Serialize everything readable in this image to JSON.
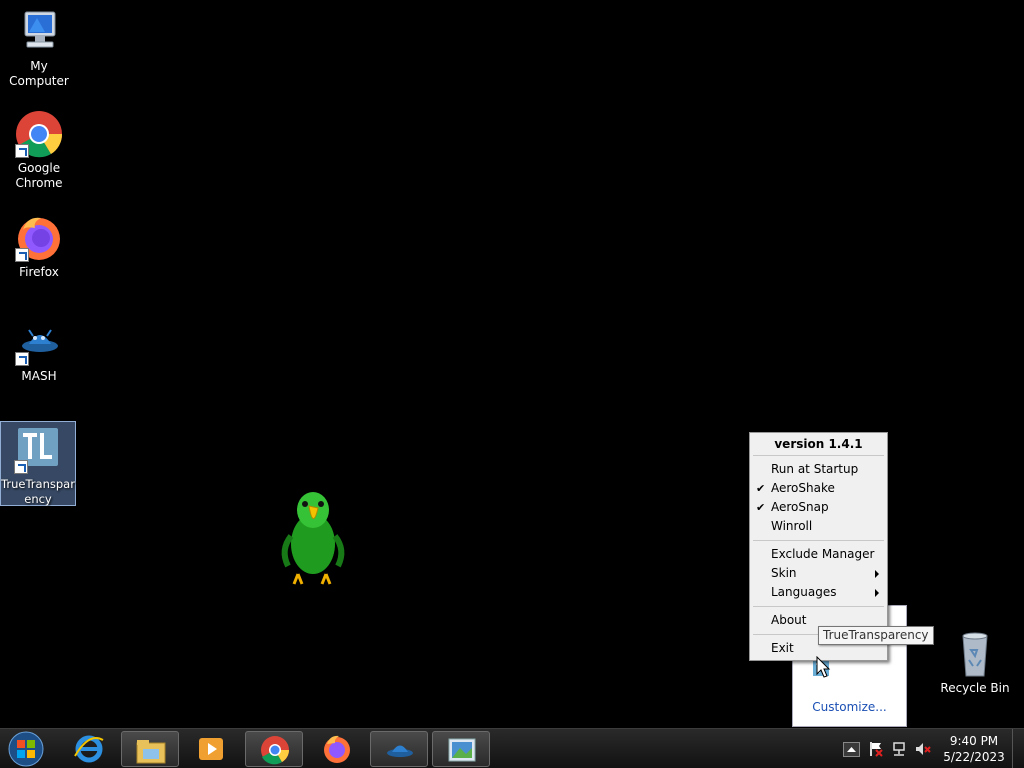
{
  "desktop": {
    "icons": [
      {
        "label": "My Computer"
      },
      {
        "label": "Google Chrome"
      },
      {
        "label": "Firefox"
      },
      {
        "label": "MASH"
      },
      {
        "label": "TrueTransparency"
      },
      {
        "label": "Recycle Bin"
      }
    ]
  },
  "menu": {
    "version": "version 1.4.1",
    "items": [
      {
        "label": "Run at Startup",
        "checked": false
      },
      {
        "label": "AeroShake",
        "checked": true
      },
      {
        "label": "AeroSnap",
        "checked": true
      },
      {
        "label": "Winroll",
        "checked": false
      },
      {
        "label": "Exclude Manager",
        "submenu": false
      },
      {
        "label": "Skin",
        "submenu": true
      },
      {
        "label": "Languages",
        "submenu": true
      },
      {
        "label": "About"
      },
      {
        "label": "Exit"
      }
    ],
    "check_glyph": "✔"
  },
  "tooltip": {
    "text": "TrueTransparency"
  },
  "tray_popup": {
    "customize_label": "Customize..."
  },
  "taskbar": {
    "apps": [
      "start-orb-icon",
      "internet-explorer-icon",
      "file-explorer-icon",
      "media-player-icon",
      "chrome-icon",
      "firefox-icon",
      "mash-icon",
      "image-viewer-icon"
    ],
    "clock_time": "9:40 PM",
    "clock_date": "5/22/2023"
  },
  "colors": {
    "desktop": "#000000",
    "link": "#1a4fb4",
    "selection": "#78a0dc"
  }
}
